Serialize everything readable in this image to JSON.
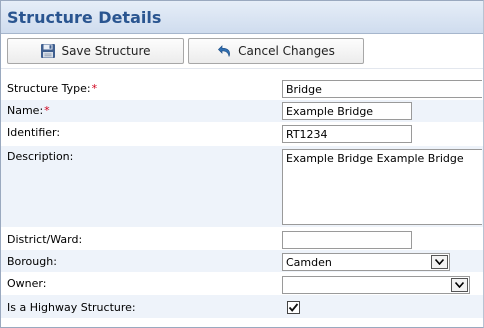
{
  "panel": {
    "title": "Structure Details"
  },
  "toolbar": {
    "save_label": "Save Structure",
    "save_icon": "floppy-disk-icon",
    "cancel_label": "Cancel Changes",
    "cancel_icon": "undo-arrow-icon"
  },
  "form": {
    "structure_type": {
      "label": "Structure Type:",
      "required": "*",
      "value": "Bridge"
    },
    "name": {
      "label": "Name:",
      "required": "*",
      "value": "Example Bridge"
    },
    "identifier": {
      "label": "Identifier:",
      "value": "RT1234"
    },
    "description": {
      "label": "Description:",
      "value": "Example Bridge Example Bridge"
    },
    "district_ward": {
      "label": "District/Ward:",
      "value": ""
    },
    "borough": {
      "label": "Borough:",
      "value": "Camden"
    },
    "owner": {
      "label": "Owner:",
      "value": ""
    },
    "highway_structure": {
      "label": "Is a Highway Structure:",
      "checked": true
    }
  },
  "colors": {
    "title": "#2a5590",
    "required_marker": "#d0021b",
    "row_alt": "#eef3fa",
    "header_gradient_top": "#e6eef8",
    "header_gradient_bottom": "#cfdcee"
  }
}
